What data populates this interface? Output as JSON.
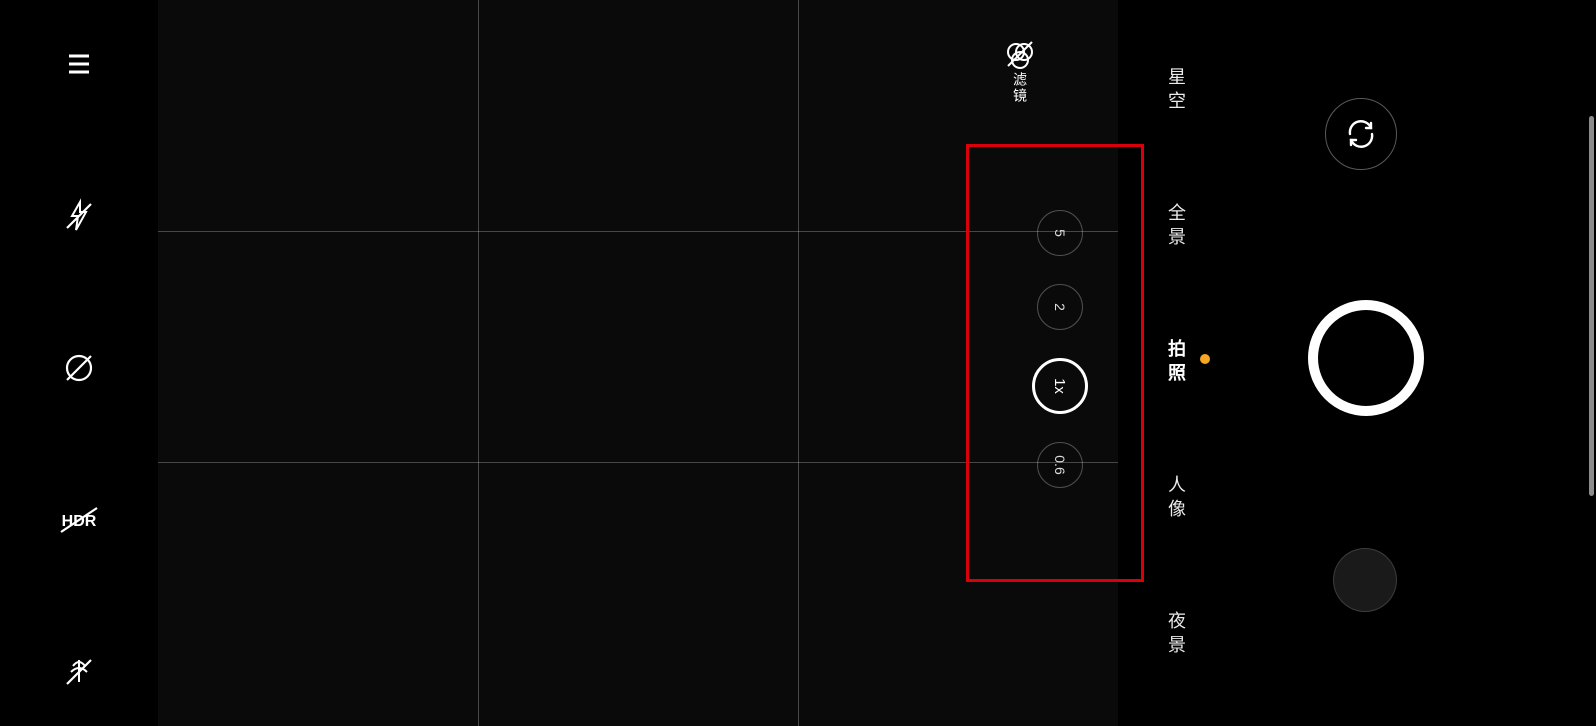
{
  "filter": {
    "label": "滤镜"
  },
  "zoom": {
    "levels": [
      "5",
      "2",
      "1x",
      "0.6"
    ],
    "active_index": 2
  },
  "modes": {
    "items": [
      "星空",
      "全景",
      "拍照",
      "人像",
      "夜景"
    ],
    "active_index": 2
  },
  "icons": {
    "menu": "menu-icon",
    "flash_off": "flash-off-icon",
    "auto_enhance_off": "auto-enhance-off-icon",
    "hdr_off": "hdr-off-icon",
    "macro_off": "macro-off-icon",
    "filter": "filter-icon",
    "switch_camera": "switch-camera-icon"
  }
}
